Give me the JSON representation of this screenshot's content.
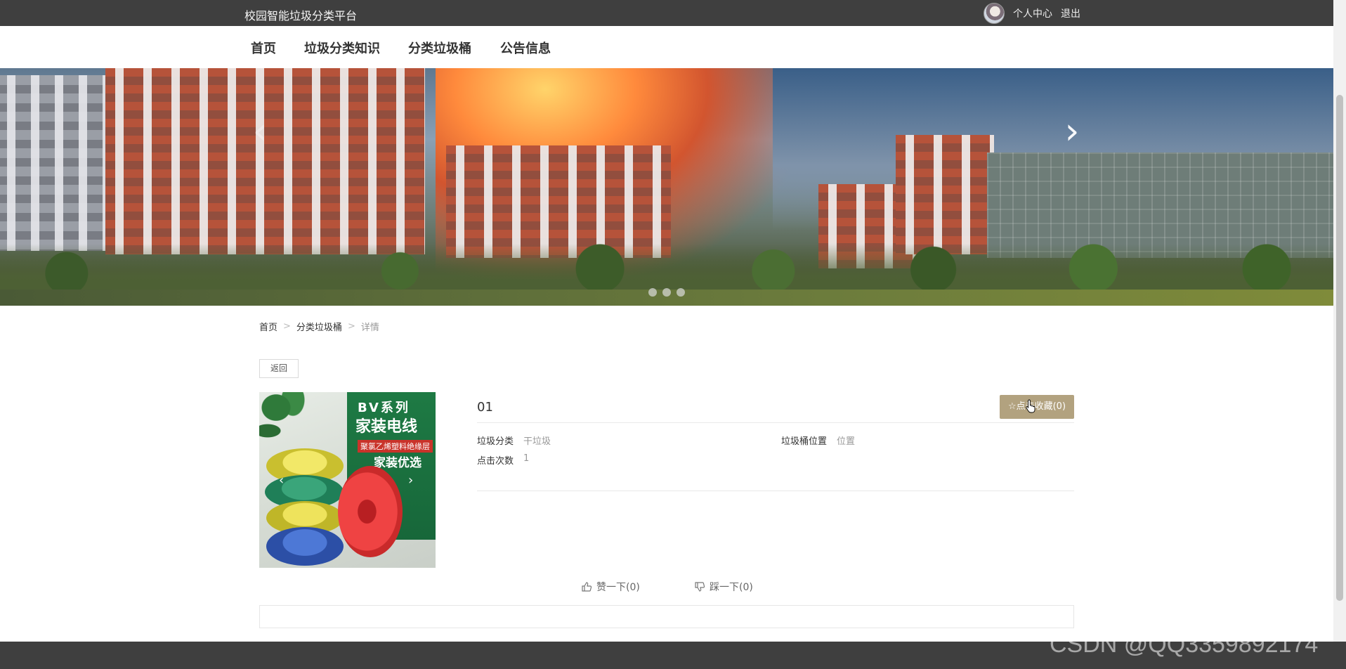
{
  "site": {
    "title": "校园智能垃圾分类平台"
  },
  "user": {
    "profile_label": "个人中心",
    "logout_label": "退出"
  },
  "nav": {
    "items": [
      {
        "label": "首页"
      },
      {
        "label": "垃圾分类知识"
      },
      {
        "label": "分类垃圾桶"
      },
      {
        "label": "公告信息"
      }
    ]
  },
  "banner": {
    "prev_glyph": "‹",
    "next_glyph": "›",
    "slide_count": 3
  },
  "breadcrumb": {
    "items": [
      {
        "label": "首页"
      },
      {
        "label": "分类垃圾桶"
      },
      {
        "label": "详情"
      }
    ],
    "separator": ">"
  },
  "back_label": "返回",
  "product_image": {
    "series_text": "BV系列",
    "brand_text": "家装电线",
    "sub_text": "聚氯乙烯塑料绝缘层",
    "tag_text": "家装优选"
  },
  "detail": {
    "title": "01",
    "favorite_label": "☆点击收藏(0)",
    "fields": [
      {
        "label": "垃圾分类",
        "value": "干垃圾"
      },
      {
        "label": "垃圾桶位置",
        "value": "位置"
      },
      {
        "label": "点击次数",
        "value": "1"
      }
    ]
  },
  "votes": {
    "like_label": "赞一下(0)",
    "dislike_label": "踩一下(0)"
  },
  "watermark": "CSDN @QQ3359892174",
  "colors": {
    "topbar_bg": "#3f3f3f",
    "favorite_bg": "#b2a27f",
    "footer_bg": "#3f3f3f"
  }
}
